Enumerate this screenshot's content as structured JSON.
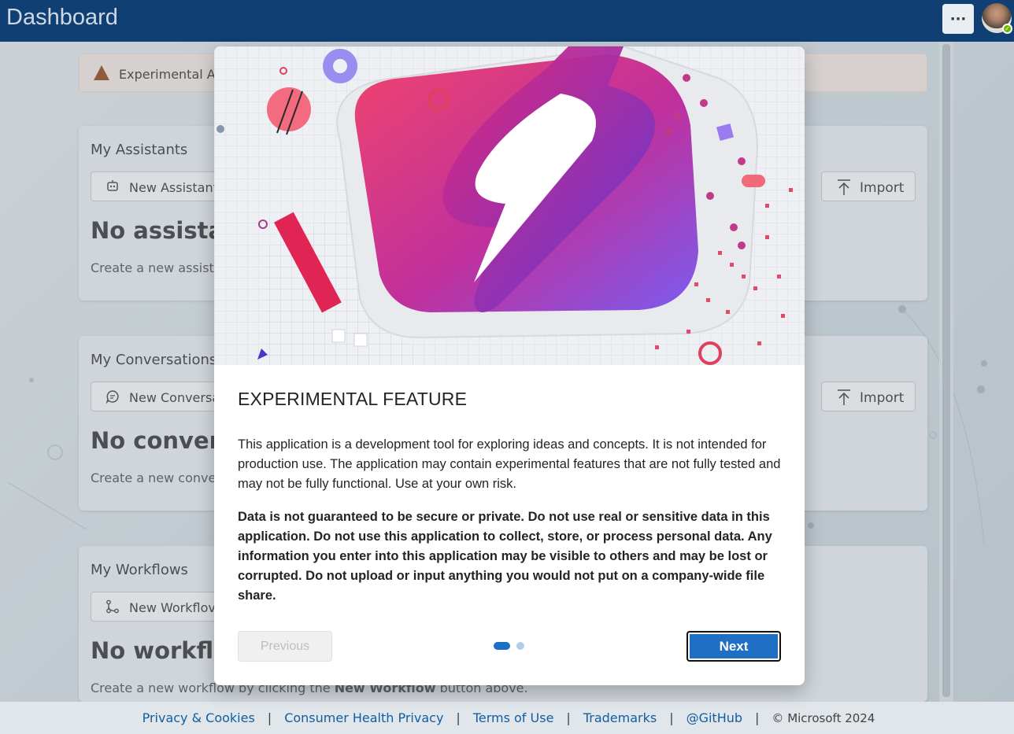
{
  "header": {
    "title": "Dashboard",
    "more_label": "···"
  },
  "warning": {
    "text": "Experimental A"
  },
  "cards": {
    "assistants": {
      "title": "My Assistants",
      "new_label": "New Assistant",
      "import_label": "Import",
      "heading": "No assistant",
      "description": "Create a new assistar"
    },
    "conversations": {
      "title": "My Conversations",
      "new_label": "New Conversa",
      "import_label": "Import",
      "heading": "No conversa",
      "description": "Create a new conver"
    },
    "workflows": {
      "title": "My Workflows",
      "new_label": "New Workflov",
      "heading": "No workflov",
      "description_prefix": "Create a new workflow by clicking the ",
      "description_bold": "New Workflow",
      "description_suffix": " button above."
    }
  },
  "dialog": {
    "title": "EXPERIMENTAL FEATURE",
    "body1": "This application is a development tool for exploring ideas and concepts. It is not intended for production use. The application may contain experimental features that are not fully tested and may not be fully functional. Use at your own risk.",
    "body2": "Data is not guaranteed to be secure or private. Do not use real or sensitive data in this application. Do not use this application to collect, store, or process personal data. Any information you enter into this application may be visible to others and may be lost or corrupted. Do not upload or input anything you would not put on a company-wide file share.",
    "previous_label": "Previous",
    "next_label": "Next",
    "page_count": 2,
    "current_page": 1
  },
  "footer": {
    "links": [
      "Privacy & Cookies",
      "Consumer Health Privacy",
      "Terms of Use",
      "Trademarks",
      "@GitHub"
    ],
    "copyright": "© Microsoft 2024"
  },
  "colors": {
    "header_bg": "#0f3f73",
    "accent": "#1f6fc5",
    "warning_icon": "#8a3707"
  }
}
